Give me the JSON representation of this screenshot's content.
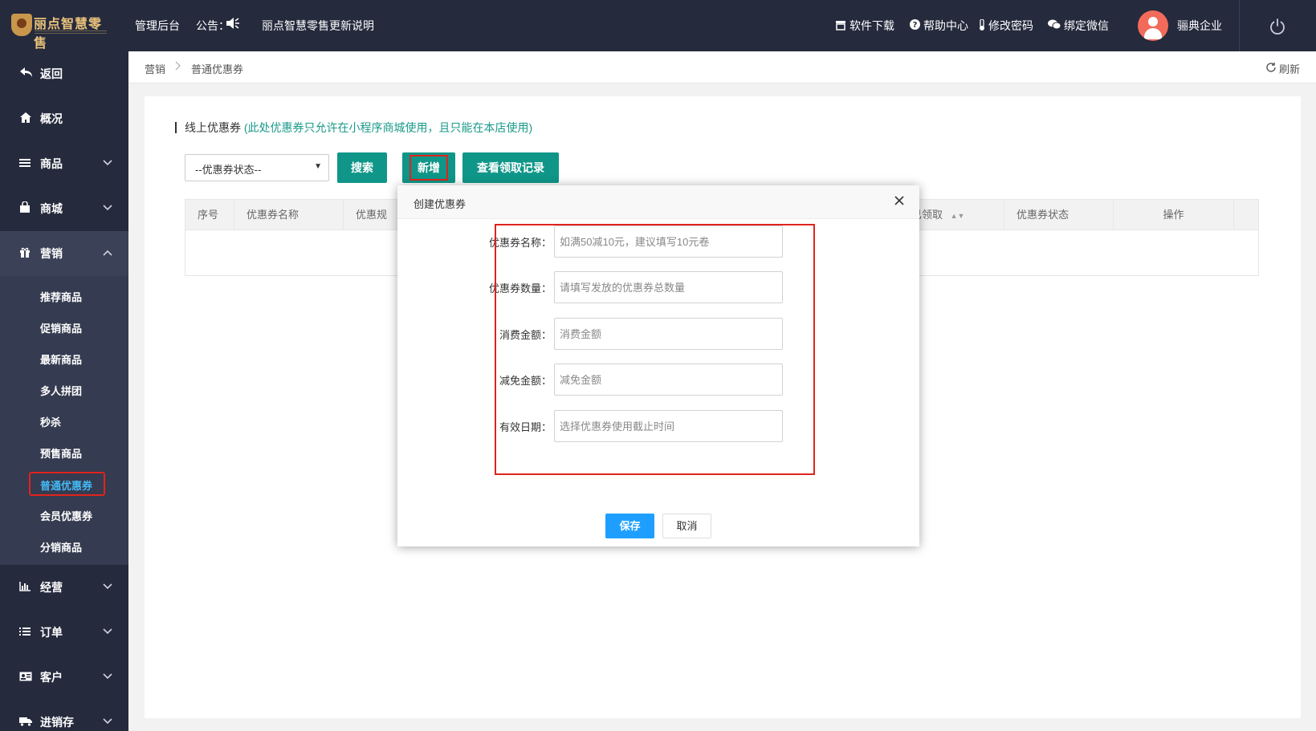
{
  "topbar": {
    "logo_text": "丽点智慧零售",
    "admin_label": "管理后台",
    "notice_label": "公告：",
    "notice_text": "丽点智慧零售更新说明",
    "links": {
      "download": "软件下载",
      "help": "帮助中心",
      "password": "修改密码",
      "wechat": "绑定微信"
    },
    "company": "骊典企业"
  },
  "sidebar": {
    "back": "返回",
    "overview": "概况",
    "goods": "商品",
    "mall": "商城",
    "marketing": "营销",
    "marketing_sub": [
      "推荐商品",
      "促销商品",
      "最新商品",
      "多人拼团",
      "秒杀",
      "预售商品",
      "普通优惠券",
      "会员优惠券",
      "分销商品"
    ],
    "operation": "经营",
    "orders": "订单",
    "customers": "客户",
    "inventory": "进销存"
  },
  "breadcrumb": {
    "parent": "营销",
    "current": "普通优惠券",
    "refresh": "刷新"
  },
  "main": {
    "section_title": "线上优惠券",
    "section_note": "(此处优惠券只允许在小程序商城使用，且只能在本店使用)",
    "status_select": "--优惠券状态--",
    "search_button": "搜索",
    "add_button": "新增",
    "records_button": "查看领取记录",
    "columns": [
      "序号",
      "优惠券名称",
      "优惠规",
      "已领取",
      "优惠券状态",
      "操作"
    ]
  },
  "modal": {
    "title": "创建优惠券",
    "fields": [
      {
        "label": "优惠券名称：",
        "placeholder": "如满50减10元，建议填写10元卷"
      },
      {
        "label": "优惠券数量：",
        "placeholder": "请填写发放的优惠券总数量"
      },
      {
        "label": "消费金额：",
        "placeholder": "消费金额"
      },
      {
        "label": "减免金额：",
        "placeholder": "减免金额"
      },
      {
        "label": "有效日期：",
        "placeholder": "选择优惠券使用截止时间"
      }
    ],
    "save": "保存",
    "cancel": "取消"
  },
  "colors": {
    "nav_bg": "#252a3d",
    "primary_green": "#0f9688",
    "primary_blue": "#1e9fff",
    "highlight_red": "#e0231c",
    "active_sub_text": "#43b9f5"
  }
}
